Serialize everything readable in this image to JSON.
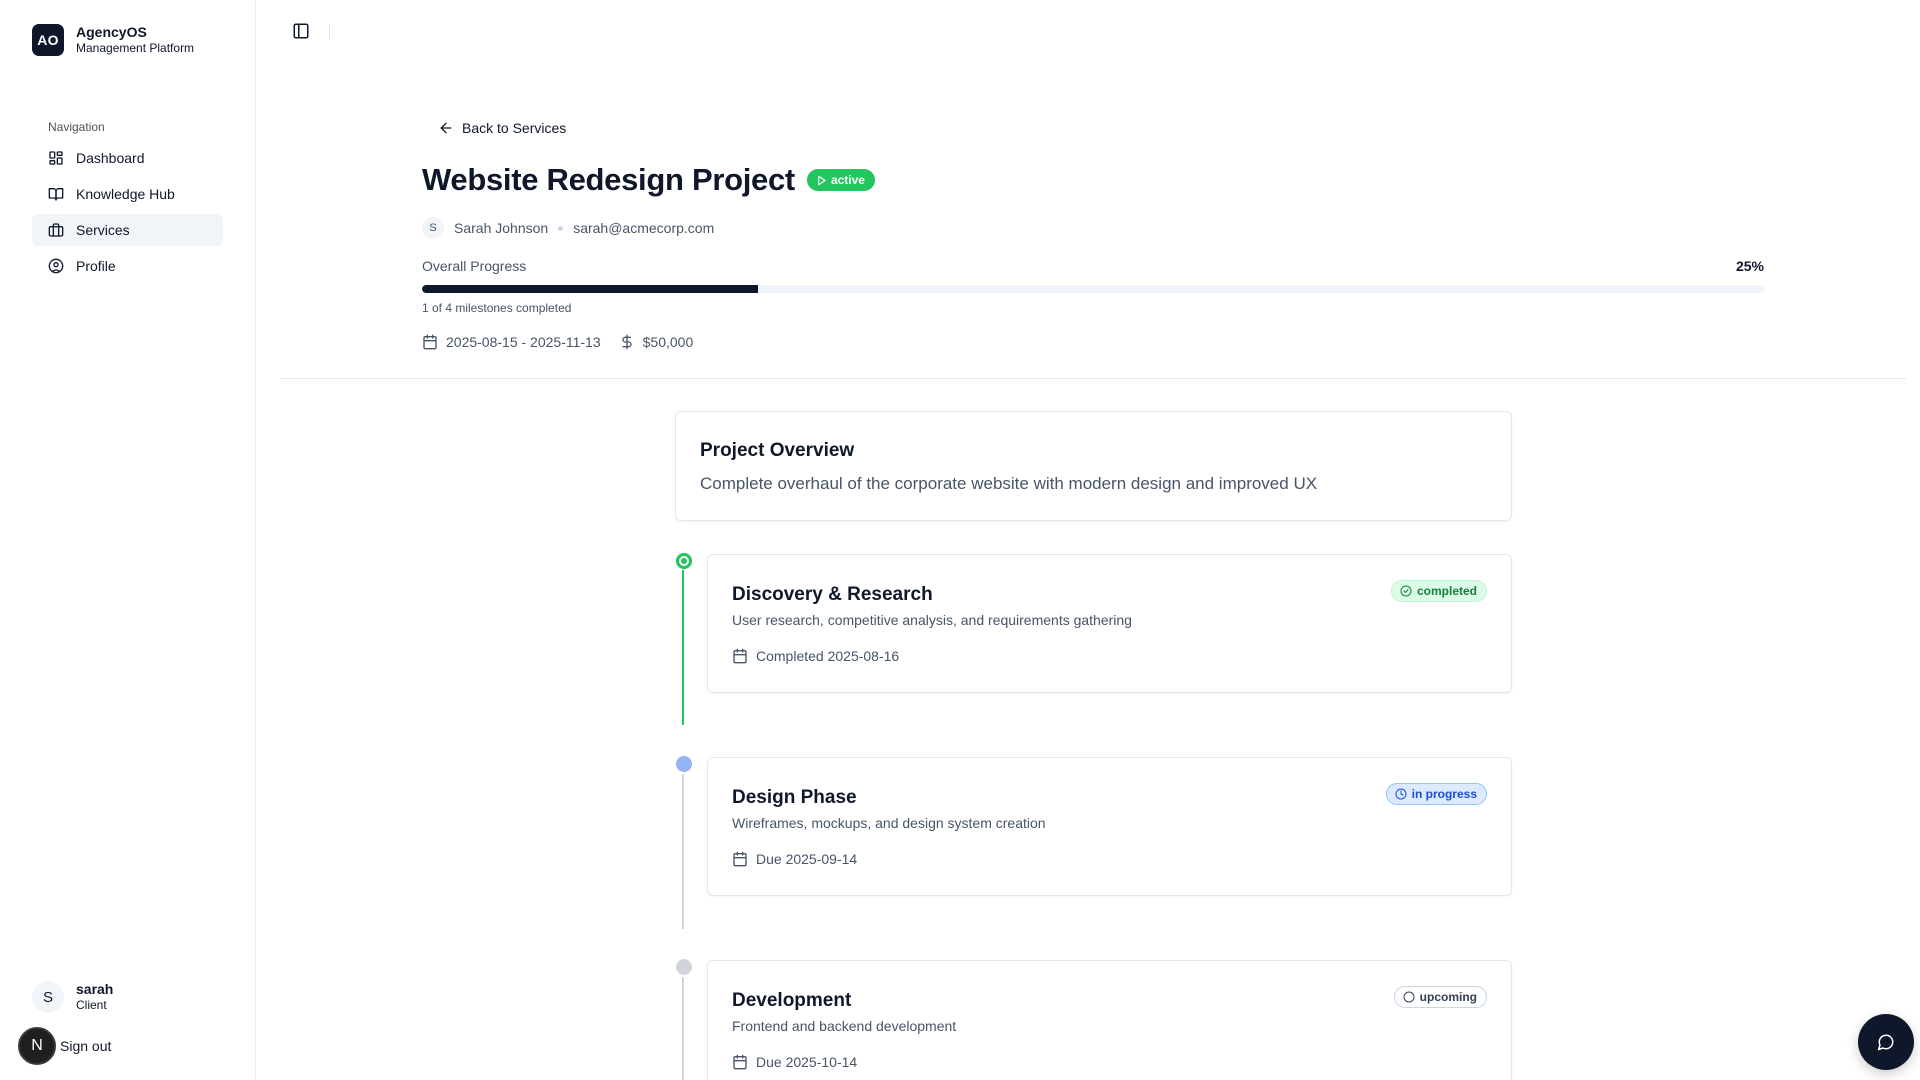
{
  "brand": {
    "logo": "AO",
    "name": "AgencyOS",
    "subtitle": "Management Platform"
  },
  "sidebar": {
    "section_label": "Navigation",
    "items": [
      {
        "label": "Dashboard",
        "icon": "dashboard-icon",
        "active": false
      },
      {
        "label": "Knowledge Hub",
        "icon": "book-icon",
        "active": false
      },
      {
        "label": "Services",
        "icon": "briefcase-icon",
        "active": true
      },
      {
        "label": "Profile",
        "icon": "user-circle-icon",
        "active": false
      }
    ],
    "user": {
      "initial": "S",
      "name": "sarah",
      "role": "Client"
    },
    "signout_label": "Sign out",
    "n_badge": "N"
  },
  "header": {
    "back_label": "Back to Services",
    "title": "Website Redesign Project",
    "status": "active",
    "client": {
      "initial": "S",
      "name": "Sarah Johnson",
      "email": "sarah@acmecorp.com"
    },
    "progress": {
      "label": "Overall Progress",
      "percent_text": "25%",
      "fraction": 0.25,
      "summary": "1 of 4 milestones completed"
    },
    "dates": "2025-08-15 - 2025-11-13",
    "budget": "$50,000"
  },
  "overview": {
    "title": "Project Overview",
    "description": "Complete overhaul of the corporate website with modern design and improved UX"
  },
  "milestones": [
    {
      "title": "Discovery & Research",
      "description": "User research, competitive analysis, and requirements gathering",
      "date": "Completed 2025-08-16",
      "status": "completed"
    },
    {
      "title": "Design Phase",
      "description": "Wireframes, mockups, and design system creation",
      "date": "Due 2025-09-14",
      "status": "in progress"
    },
    {
      "title": "Development",
      "description": "Frontend and backend development",
      "date": "Due 2025-10-14",
      "status": "upcoming"
    }
  ],
  "colors": {
    "primary": "#0f172a",
    "success": "#22c55e",
    "info": "#93b4f5",
    "muted": "#d1d5db"
  }
}
